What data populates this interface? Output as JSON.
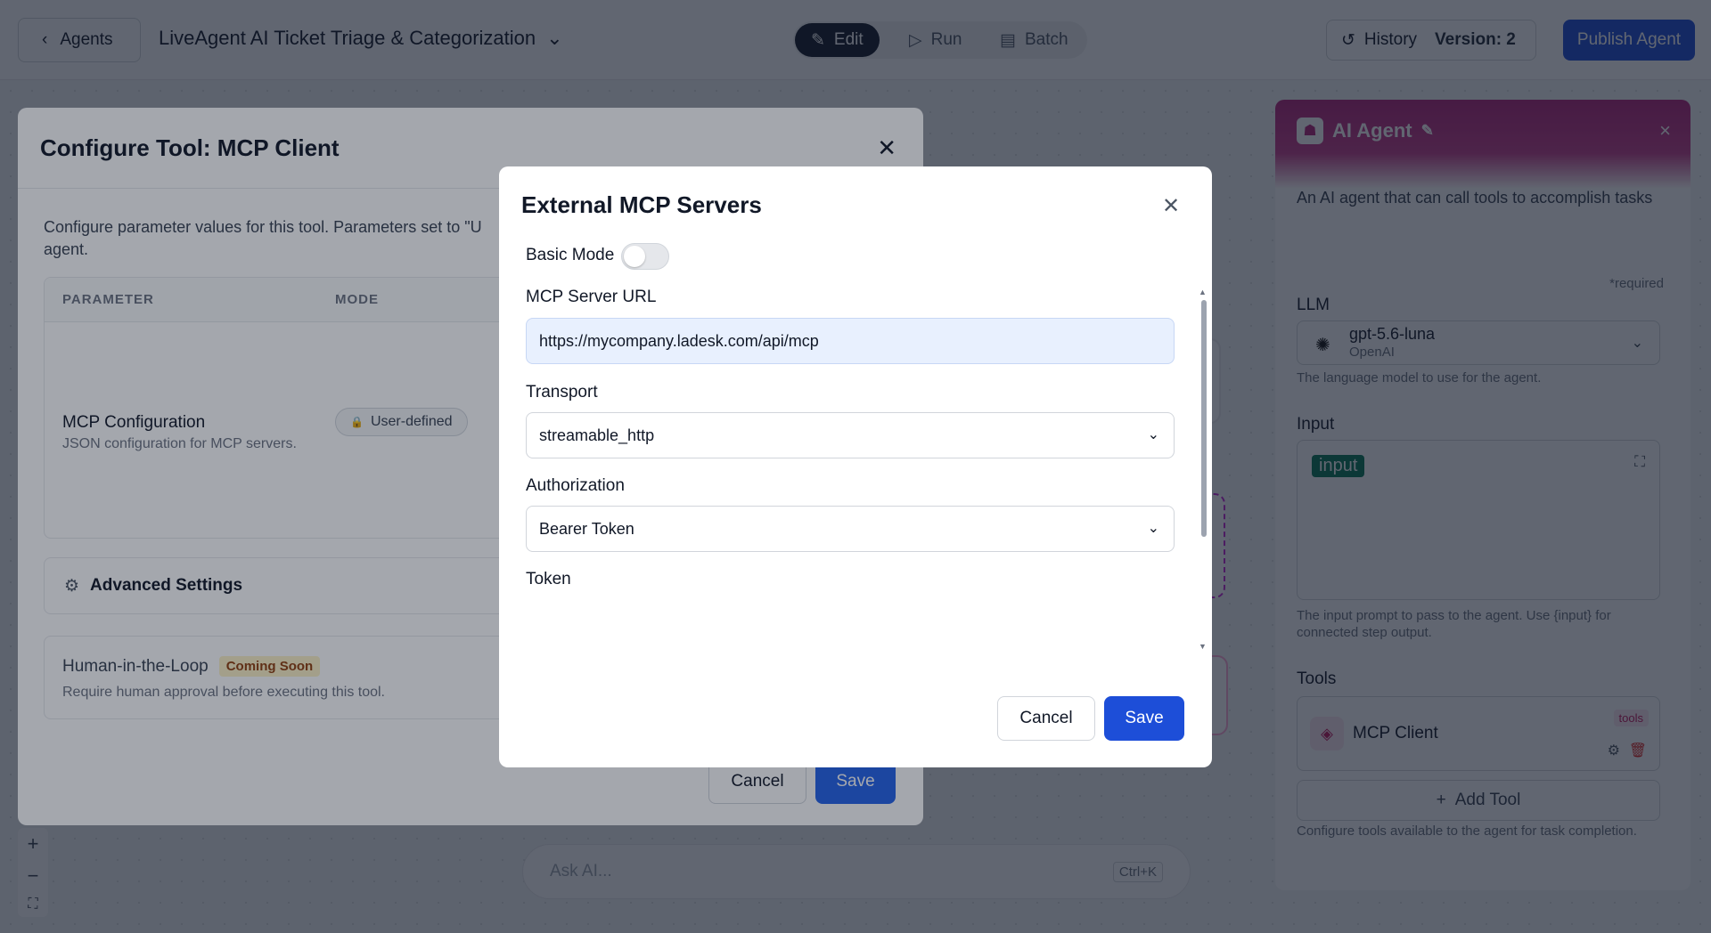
{
  "topbar": {
    "back_label": "Agents",
    "agent_title": "LiveAgent AI Ticket Triage & Categorization",
    "modes": [
      {
        "label": "Edit",
        "icon": "pencil-icon"
      },
      {
        "label": "Run",
        "icon": "play-icon"
      },
      {
        "label": "Batch",
        "icon": "batch-icon"
      }
    ],
    "history_label": "History",
    "version_label": "Version: 2",
    "publish_label": "Publish Agent"
  },
  "canvas": {
    "ask_ai_placeholder": "Ask AI...",
    "ask_ai_shortcut": "Ctrl+K",
    "zoom_in": "+",
    "zoom_out": "−",
    "fit_icon": "⛶"
  },
  "right_panel": {
    "title": "AI Agent",
    "description": "An AI agent that can call tools to accomplish tasks",
    "required_note": "*required",
    "llm_label": "LLM",
    "llm_model": "gpt-5.6-luna",
    "llm_provider": "OpenAI",
    "llm_help": "The language model to use for the agent.",
    "input_label": "Input",
    "input_tag": "input",
    "input_help": "The input prompt to pass to the agent. Use {input} for connected step output.",
    "tools_label": "Tools",
    "tool_name": "MCP Client",
    "tool_badge": "tools",
    "add_tool_label": "Add Tool",
    "tools_help": "Configure tools available to the agent for task completion."
  },
  "configure_modal": {
    "title": "Configure Tool: MCP Client",
    "description": "Configure parameter values for this tool. Parameters set to \"U",
    "description_cont": "agent.",
    "columns": [
      "PARAMETER",
      "MODE"
    ],
    "param_name": "MCP Configuration",
    "param_desc": "JSON configuration for MCP servers.",
    "param_mode": "User-defined",
    "advanced_label": "Advanced Settings",
    "hitl_title": "Human-in-the-Loop",
    "hitl_badge": "Coming Soon",
    "hitl_desc": "Require human approval before executing this tool.",
    "cancel_label": "Cancel",
    "save_label": "Save"
  },
  "mcp_modal": {
    "title": "External MCP Servers",
    "basic_mode_label": "Basic Mode",
    "basic_mode_on": false,
    "url_label": "MCP Server URL",
    "url_value": "https://mycompany.ladesk.com/api/mcp",
    "transport_label": "Transport",
    "transport_value": "streamable_http",
    "auth_label": "Authorization",
    "auth_value": "Bearer Token",
    "token_label": "Token",
    "token_value": "••••••••••••••••••••••••••••••••••••••••••••••••••••••••••••",
    "cancel_label": "Cancel",
    "save_label": "Save"
  },
  "colors": {
    "primary": "#1d4ed8",
    "agent_accent": "#b1227b",
    "input_tag": "#047857"
  }
}
